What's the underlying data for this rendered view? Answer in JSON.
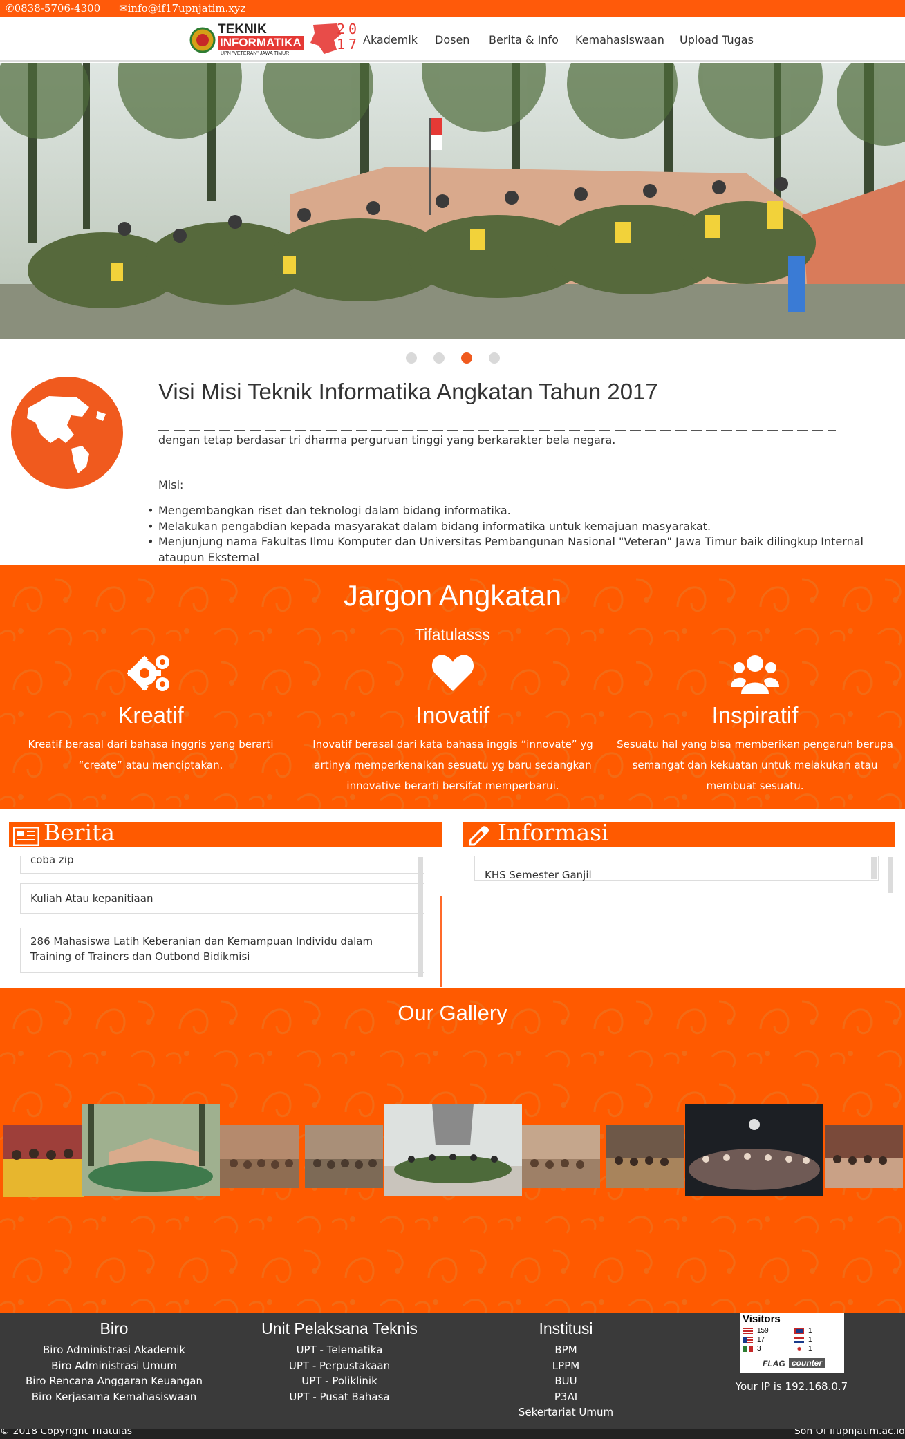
{
  "topbar": {
    "phone": "0838-5706-4300",
    "email": "info@if17upnjatim.xyz",
    "bg_color": "#ff5a0a"
  },
  "logo": {
    "line1": "TEKNIK",
    "line2": "INFORMATIKA",
    "line3": "UPN \"VETERAN\" JAWA TIMUR",
    "year_top": "20",
    "year_bottom": "17"
  },
  "nav": {
    "items": [
      "Akademik",
      "Dosen",
      "Berita & Info",
      "Kemahasiswaan",
      "Upload Tugas"
    ]
  },
  "carousel": {
    "slides": 4,
    "active_index": 2
  },
  "visi": {
    "title": "Visi Misi Teknik Informatika Angkatan Tahun 2017",
    "text": "dengan tetap berdasar tri dharma perguruan tinggi yang berkarakter bela negara.",
    "misi_label": "Misi:",
    "misi_items": [
      "Mengembangkan riset dan teknologi dalam bidang informatika.",
      "Melakukan pengabdian kepada masyarakat dalam bidang informatika untuk kemajuan masyarakat.",
      "Menjunjung nama Fakultas Ilmu Komputer dan Universitas Pembangunan Nasional \"Veteran\" Jawa Timur baik dilingkup Internal ataupun Eksternal"
    ]
  },
  "jargon": {
    "title": "Jargon Angkatan",
    "subtitle": "Tifatulasss",
    "features": [
      {
        "icon": "gears-icon",
        "title": "Kreatif",
        "text": "Kreatif berasal dari bahasa inggris yang berarti “create” atau menciptakan."
      },
      {
        "icon": "heart-icon",
        "title": "Inovatif",
        "text": "Inovatif berasal dari kata bahasa inggis “innovate” yg artinya memperkenalkan sesuatu yg baru sedangkan innovative berarti bersifat memperbarui."
      },
      {
        "icon": "users-icon",
        "title": "Inspiratif",
        "text": "Sesuatu hal yang bisa memberikan pengaruh berupa semangat dan kekuatan untuk melakukan atau membuat sesuatu."
      }
    ]
  },
  "berita": {
    "title": "Berita",
    "items": [
      "coba zip",
      "Kuliah Atau kepanitiaan",
      "286 Mahasiswa Latih Keberanian dan Kemampuan Individu dalam Training of Trainers dan Outbond Bidikmisi"
    ]
  },
  "informasi": {
    "title": "Informasi",
    "items": [
      "KHS Semester Ganjil"
    ]
  },
  "gallery": {
    "title": "Our Gallery"
  },
  "footer": {
    "biro": {
      "title": "Biro",
      "items": [
        "Biro Administrasi Akademik",
        "Biro Administrasi Umum",
        "Biro Rencana Anggaran Keuangan",
        "Biro Kerjasama Kemahasiswaan"
      ]
    },
    "upt": {
      "title": "Unit Pelaksana Teknis",
      "items": [
        "UPT - Telematika",
        "UPT - Perpustakaan",
        "UPT - Poliklinik",
        "UPT - Pusat Bahasa"
      ]
    },
    "institusi": {
      "title": "Institusi",
      "items": [
        "BPM",
        "LPPM",
        "BUU",
        "P3AI",
        "Sekertariat Umum"
      ]
    },
    "flag_counter": {
      "title": "Visitors",
      "rows": [
        [
          "159",
          "1"
        ],
        [
          "17",
          "1"
        ],
        [
          "3",
          "1"
        ]
      ],
      "brand": "FLAG",
      "brand2": "counter"
    },
    "ip_text": "Your IP is 192.168.0.7"
  },
  "bottom": {
    "copyright": "© 2018 Copyright Tifatulas",
    "right": "Son Of ifupnjatim.ac.id"
  }
}
